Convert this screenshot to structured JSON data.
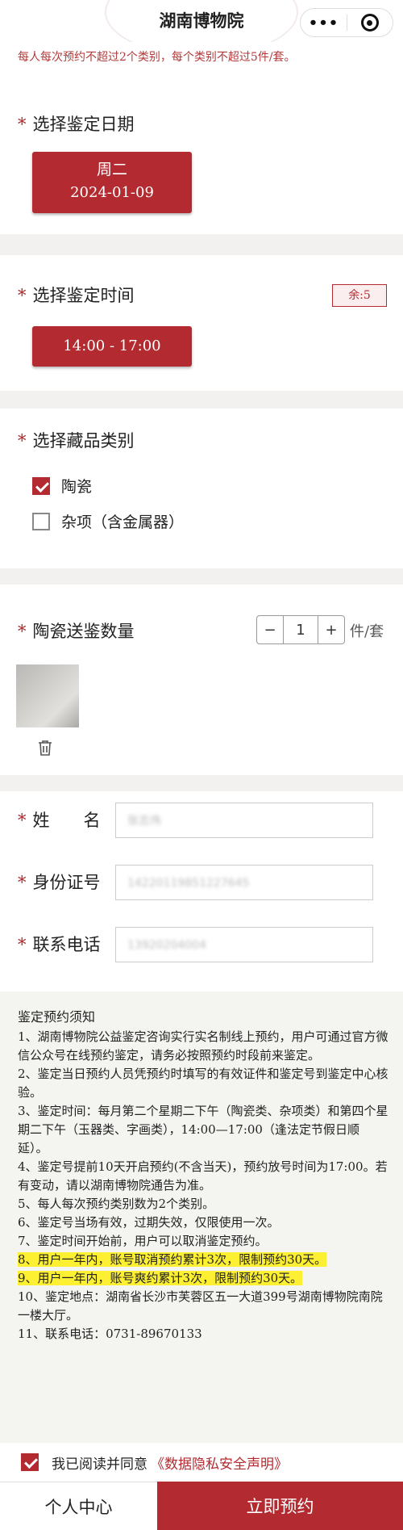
{
  "app": {
    "title": "湖南博物院",
    "menu_icon": "more-dots-icon",
    "close_icon": "target-circle-icon"
  },
  "notice": "每人每次预约不超过2个类别，每个类别不超过5件/套。",
  "date_section": {
    "title": "选择鉴定日期",
    "weekday": "周二",
    "date": "2024-01-09"
  },
  "time_section": {
    "title": "选择鉴定时间",
    "remaining": "余:5",
    "slot": "14:00 - 17:00"
  },
  "category_section": {
    "title": "选择藏品类别",
    "options": [
      {
        "label": "陶瓷",
        "checked": true
      },
      {
        "label": "杂项（含金属器）",
        "checked": false
      }
    ]
  },
  "quantity_section": {
    "title": "陶瓷送鉴数量",
    "minus": "−",
    "value": "1",
    "plus": "+",
    "unit": "件/套"
  },
  "form": {
    "name_label": "姓　　名",
    "name_value": "张志伟",
    "id_label": "身份证号",
    "id_value": "14220119851227645",
    "phone_label": "联系电话",
    "phone_value": "13920204004"
  },
  "rules": {
    "title": "鉴定预约须知",
    "items": [
      "1、湖南博物院公益鉴定咨询实行实名制线上预约，用户可通过官方微信公众号在线预约鉴定，请务必按照预约时段前来鉴定。",
      "2、鉴定当日预约人员凭预约时填写的有效证件和鉴定号到鉴定中心核验。",
      "3、鉴定时间：每月第二个星期二下午（陶瓷类、杂项类）和第四个星期二下午（玉器类、字画类），14:00—17:00（逢法定节假日顺延）。",
      "4、鉴定号提前10天开启预约(不含当天)，预约放号时间为17:00。若有变动，请以湖南博物院通告为准。",
      "5、每人每次预约类别数为2个类别。",
      "6、鉴定号当场有效，过期失效，仅限使用一次。",
      "7、鉴定时间开始前，用户可以取消鉴定预约。",
      "8、用户一年内，账号取消预约累计3次，限制预约30天。",
      "9、用户一年内，账号爽约累计3次，限制预约30天。",
      "10、鉴定地点：湖南省长沙市芙蓉区五一大道399号湖南博物院南院一楼大厅。",
      "11、联系电话：0731-89670133"
    ]
  },
  "agreement": {
    "prefix": "我已阅读并同意",
    "link": "《数据隐私安全声明》",
    "checked": true
  },
  "bottom_bar": {
    "personal_center": "个人中心",
    "book_now": "立即预约"
  },
  "colors": {
    "accent": "#b32a30",
    "highlight": "#fdf032"
  }
}
